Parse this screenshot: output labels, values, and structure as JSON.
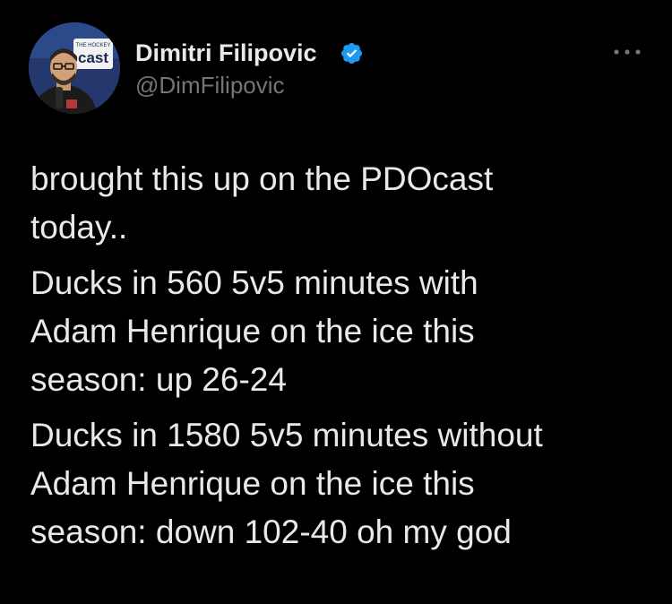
{
  "author": {
    "name": "Dimitri Filipovic",
    "handle": "@DimFilipovic",
    "verified": true,
    "avatar_badge_top": "THE HOCKEY",
    "avatar_badge_main": "cast"
  },
  "icons": {
    "verified": "verified-badge-icon",
    "more": "more-options-icon"
  },
  "colors": {
    "background": "#000000",
    "text": "#e7e9ea",
    "secondary_text": "#71767b",
    "verified_blue": "#1d9bf0"
  },
  "tweet": {
    "paragraphs": [
      "brought this up on the PDOcast\ntoday..",
      "Ducks in 560 5v5 minutes with\nAdam Henrique on the ice this\nseason: up 26-24",
      "Ducks in 1580 5v5 minutes without\nAdam Henrique on the ice this\nseason: down 102-40 oh my god"
    ]
  }
}
